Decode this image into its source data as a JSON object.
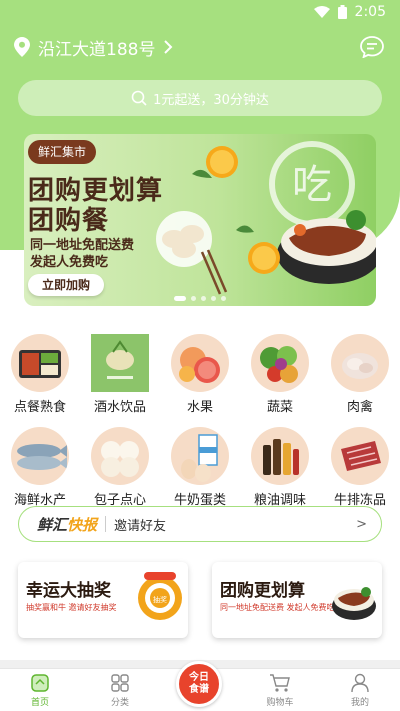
{
  "status_bar": {
    "time": "2:05"
  },
  "header": {
    "address": "沿江大道188号",
    "search_placeholder": "1元起送，30分钟达"
  },
  "banner": {
    "tag": "鲜汇集市",
    "headline_1": "团购更划算",
    "headline_2": "团购餐",
    "sub_1": "同一地址免配送费",
    "sub_2": "发起人免费吃",
    "button": "立即加购",
    "logo_char": "吃"
  },
  "categories": [
    {
      "label": "点餐熟食",
      "icon": "bento-image"
    },
    {
      "label": "酒水饮品",
      "icon": "drinks-image"
    },
    {
      "label": "水果",
      "icon": "fruit-image"
    },
    {
      "label": "蔬菜",
      "icon": "vegetables-image"
    },
    {
      "label": "肉禽",
      "icon": "meat-image"
    },
    {
      "label": "海鲜水产",
      "icon": "seafood-image"
    },
    {
      "label": "包子点心",
      "icon": "buns-image"
    },
    {
      "label": "牛奶蛋类",
      "icon": "milk-eggs-image"
    },
    {
      "label": "粮油调味",
      "icon": "oil-seasoning-image"
    },
    {
      "label": "牛排冻品",
      "icon": "steak-image"
    }
  ],
  "news": {
    "logo_a": "鲜汇",
    "logo_b": "快报",
    "text": "邀请好友",
    "arrow": ">"
  },
  "promos": [
    {
      "title": "幸运大抽奖",
      "sub": "抽奖赢和牛  邀请好友抽奖",
      "badge": "抽奖"
    },
    {
      "title": "团购更划算",
      "sub": "同一地址免配送费  发起人免费吃"
    }
  ],
  "nav": [
    {
      "label": "首页",
      "active": true
    },
    {
      "label": "分类",
      "active": false
    },
    {
      "label": "",
      "center_line_1": "今日",
      "center_line_2": "食谱"
    },
    {
      "label": "购物车",
      "active": false
    },
    {
      "label": "我的",
      "active": false
    }
  ],
  "colors": {
    "brand_green": "#a6e07f",
    "active_green": "#5fb52f",
    "accent_red": "#e8432c",
    "accent_orange": "#f2a41b"
  }
}
